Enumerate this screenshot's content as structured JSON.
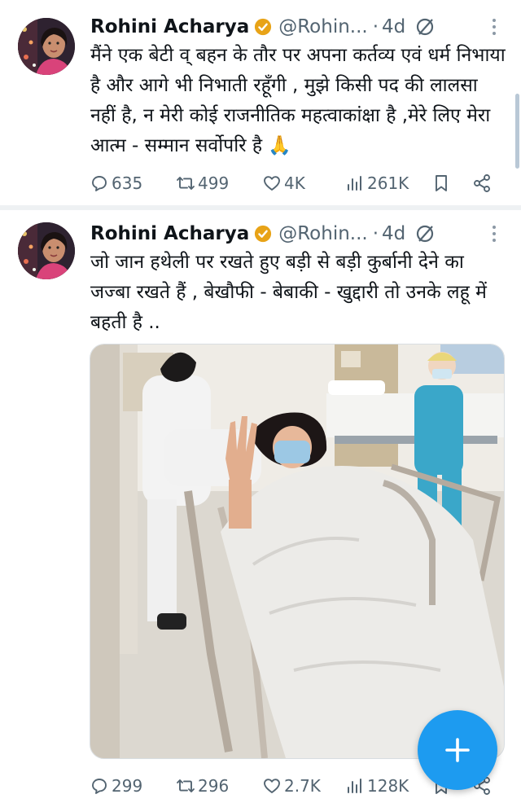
{
  "tweets": [
    {
      "author": "Rohini Acharya",
      "handle": "@Rohin...",
      "time": "4d",
      "text": "मैंने एक बेटी व् बहन के तौर पर अपना कर्तव्य एवं धर्म निभाया है और आगे भी निभाती रहूँगी , मुझे किसी पद की लालसा नहीं है, न मेरी कोई राजनीतिक महत्वाकांक्षा है ,मेरे लिए मेरा आत्म - सम्मान सर्वोपरि है 🙏",
      "replies": "635",
      "retweets": "499",
      "likes": "4K",
      "views": "261K"
    },
    {
      "author": "Rohini Acharya",
      "handle": "@Rohin...",
      "time": "4d",
      "text": "जो जान हथेली पर रखते हुए बड़ी से बड़ी कुर्बानी देने का जज्बा रखते हैं , बेखौफी - बेबाकी - खुद्दारी तो उनके लहू में बहती है ..",
      "replies": "299",
      "retweets": "296",
      "likes": "2.7K",
      "views": "128K"
    }
  ],
  "icons": {
    "verified": "verified-badge-icon",
    "muted": "no-sign-icon",
    "more": "more-vertical-icon",
    "reply": "reply-icon",
    "retweet": "retweet-icon",
    "like": "heart-icon",
    "views": "views-icon",
    "bookmark": "bookmark-icon",
    "share": "share-icon",
    "compose": "plus-icon"
  },
  "colors": {
    "accent": "#1d9bf0",
    "text": "#0f1419",
    "muted": "#536471"
  }
}
